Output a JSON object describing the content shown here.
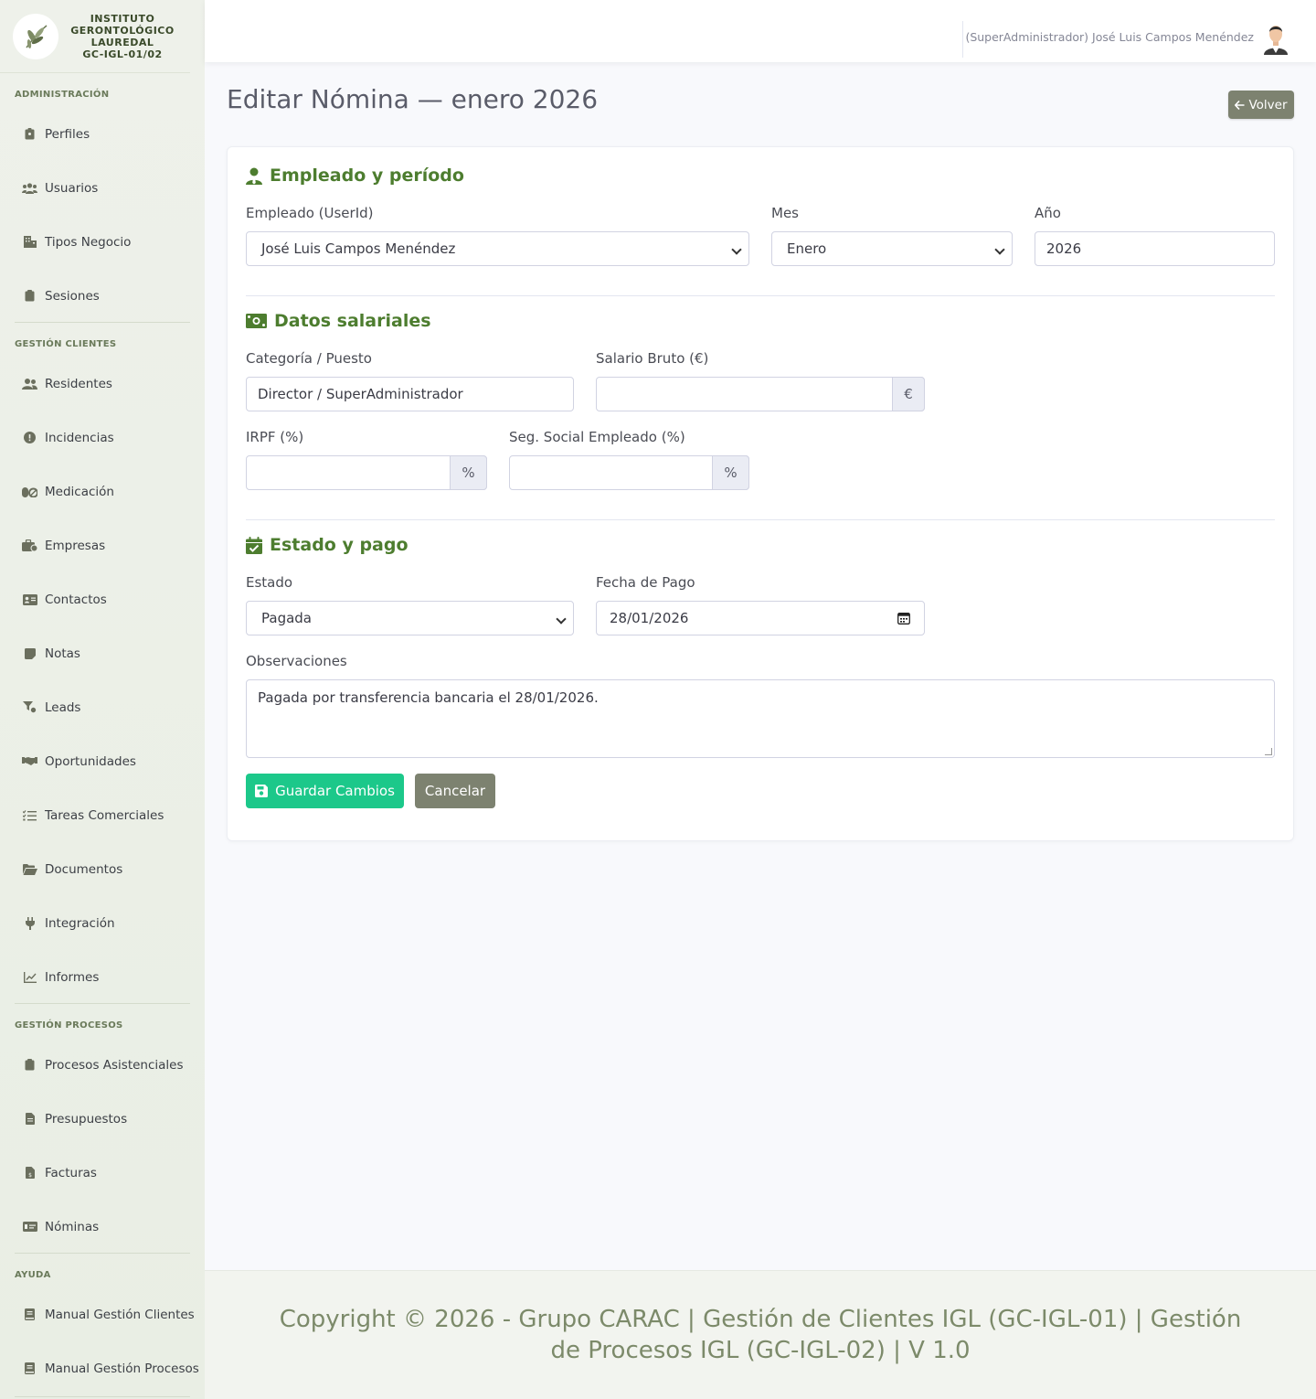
{
  "brand": {
    "line1": "INSTITUTO",
    "line2": "GERONTOLÓGICO",
    "line3": "LAUREDAL",
    "line4": "GC-IGL-01/02",
    "logo_icon": "olive-branch-icon"
  },
  "sidebar": {
    "sections": [
      {
        "title": "ADMINISTRACIÓN",
        "items": [
          {
            "label": "Perfiles",
            "icon": "id-badge-icon"
          },
          {
            "label": "Usuarios",
            "icon": "users-icon"
          },
          {
            "label": "Tipos Negocio",
            "icon": "building-icon"
          },
          {
            "label": "Sesiones",
            "icon": "clipboard-icon"
          }
        ]
      },
      {
        "title": "GESTIÓN CLIENTES",
        "items": [
          {
            "label": "Residentes",
            "icon": "user-friends-icon"
          },
          {
            "label": "Incidencias",
            "icon": "exclamation-circle-icon"
          },
          {
            "label": "Medicación",
            "icon": "pills-icon"
          },
          {
            "label": "Empresas",
            "icon": "briefcase-icon"
          },
          {
            "label": "Contactos",
            "icon": "address-card-icon"
          },
          {
            "label": "Notas",
            "icon": "sticky-note-icon"
          },
          {
            "label": "Leads",
            "icon": "funnel-icon"
          },
          {
            "label": "Oportunidades",
            "icon": "handshake-icon"
          },
          {
            "label": "Tareas Comerciales",
            "icon": "tasks-icon"
          },
          {
            "label": "Documentos",
            "icon": "folder-open-icon"
          },
          {
            "label": "Integración",
            "icon": "plug-icon"
          },
          {
            "label": "Informes",
            "icon": "line-chart-icon"
          }
        ]
      },
      {
        "title": "GESTIÓN PROCESOS",
        "items": [
          {
            "label": "Procesos Asistenciales",
            "icon": "clipboard-icon"
          },
          {
            "label": "Presupuestos",
            "icon": "file-alt-icon"
          },
          {
            "label": "Facturas",
            "icon": "file-invoice-dollar-icon"
          },
          {
            "label": "Nóminas",
            "icon": "money-check-icon"
          }
        ]
      },
      {
        "title": "AYUDA",
        "items": [
          {
            "label": "Manual Gestión Clientes",
            "icon": "book-icon"
          },
          {
            "label": "Manual Gestión Procesos",
            "icon": "book-icon"
          }
        ]
      }
    ]
  },
  "topbar": {
    "user": "(SuperAdministrador) José Luis Campos Menéndez"
  },
  "page": {
    "title": "Editar Nómina — enero 2026",
    "back_label": "Volver"
  },
  "form": {
    "section_employee": {
      "title": "Empleado y período",
      "employee_label": "Empleado (UserId)",
      "employee_value": "José Luis Campos Menéndez",
      "month_label": "Mes",
      "month_value": "Enero",
      "year_label": "Año",
      "year_value": "2026"
    },
    "section_salary": {
      "title": "Datos salariales",
      "category_label": "Categoría / Puesto",
      "category_value": "Director / SuperAdministrador",
      "gross_label": "Salario Bruto (€)",
      "gross_value": "",
      "gross_addon": "€",
      "irpf_label": "IRPF (%)",
      "irpf_value": "",
      "irpf_addon": "%",
      "ss_label": "Seg. Social Empleado (%)",
      "ss_value": "",
      "ss_addon": "%"
    },
    "section_status": {
      "title": "Estado y pago",
      "status_label": "Estado",
      "status_value": "Pagada",
      "date_label": "Fecha de Pago",
      "date_value": "28/01/2026",
      "notes_label": "Observaciones",
      "notes_value": "Pagada por transferencia bancaria el 28/01/2026."
    },
    "save_label": "Guardar Cambios",
    "cancel_label": "Cancelar"
  },
  "footer": {
    "text": "Copyright © 2026 - Grupo CARAC | Gestión de Clientes IGL (GC-IGL-01) | Gestión de Procesos IGL (GC-IGL-02) | V 1.0"
  },
  "colors": {
    "accent_green": "#4d7d2f",
    "success": "#1cc88a",
    "secondary": "#7d8270"
  }
}
